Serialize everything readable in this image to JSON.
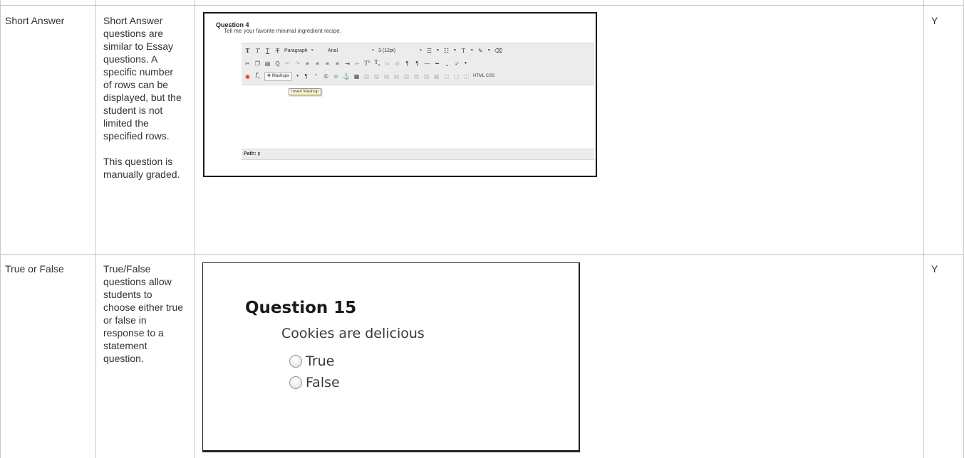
{
  "rows": [
    {
      "type": "Short Answer",
      "description": "Short Answer questions are similar to Essay questions. A specific number of rows can be displayed, but the student is not limited the specified rows.",
      "note": "This question is manually graded.",
      "flag": "Y",
      "screenshot": {
        "question_title": "Question 4",
        "question_text": "Tell me your favorite minimal ingredient recipe.",
        "format_dropdown": "Paragraph",
        "font_dropdown": "Arial",
        "size_dropdown": "3 (12pt)",
        "mashups_label": "Mashups",
        "tooltip": "Insert Mashup",
        "html_label": "HTML CSS",
        "path_label": "Path:",
        "path_value": "p"
      }
    },
    {
      "type": "True or False",
      "description": "True/False questions allow students to choose either true or false in response to a statement question.",
      "flag": "Y",
      "screenshot": {
        "question_title": "Question 15",
        "question_text": "Cookies are delicious",
        "options": [
          "True",
          "False"
        ]
      }
    }
  ]
}
